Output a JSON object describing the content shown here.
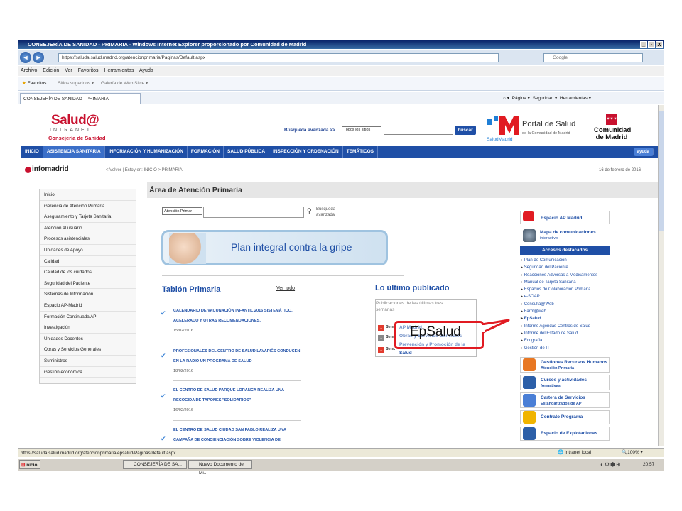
{
  "window": {
    "title": "CONSEJERÍA DE SANIDAD - PRIMARIA - Windows Internet Explorer proporcionado por Comunidad de Madrid",
    "controls": [
      "_",
      "▫",
      "X"
    ]
  },
  "browser": {
    "url": "https://saluda.salud.madrid.org/atencionprimaria/Paginas/Default.aspx",
    "search_placeholder": "Google",
    "menu": [
      "Archivo",
      "Edición",
      "Ver",
      "Favoritos",
      "Herramientas",
      "Ayuda"
    ],
    "favorites_label": "Favoritos",
    "suggested_sites": "Sitios sugeridos ▾",
    "web_slice": "Galería de Web Slice ▾",
    "tab_title": "CONSEJERÍA DE SANIDAD - PRIMARIA",
    "command_bar": [
      "Página ▾",
      "Seguridad ▾",
      "Herramientas ▾"
    ]
  },
  "header": {
    "logo_main": "Salud@",
    "logo_sub": "INTRANET",
    "logo_org": "Consejería de Sanidad",
    "advanced_search": "Búsqueda avanzada >>",
    "sites_select": "Todos los sitios",
    "search_button": "buscar",
    "portal_title": "Portal de Salud",
    "portal_sub": "de la Comunidad de Madrid",
    "salud_madrid": "SaludMadrid",
    "comunidad": "Comunidad de Madrid"
  },
  "nav": {
    "items": [
      "INICIO",
      "ASISTENCIA SANITARIA",
      "INFORMACIÓN Y HUMANIZACIÓN",
      "FORMACIÓN",
      "SALUD PÚBLICA",
      "INSPECCIÓN Y ORDENACIÓN",
      "TEMÁTICOS"
    ],
    "help": "ayuda"
  },
  "breadcrumb": {
    "site": "infomadrid",
    "back": "< Volver",
    "path": "Estoy en: INICIO > PRIMARIA",
    "date": "16 de febrero de 2016"
  },
  "sidebar": {
    "items": [
      "Inicio",
      "Gerencia de Atención Primaria",
      "Aseguramiento y Tarjeta Sanitaria",
      "Atención al usuario",
      "Procesos asistenciales",
      "Unidades de Apoyo",
      "Calidad",
      "Calidad de los cuidados",
      "Seguridad del Paciente",
      "Sistemas de Información",
      "Espacio AP-Madrid",
      "Formación Continuada AP",
      "Investigación",
      "Unidades Docentes",
      "Obras y Servicios Generales",
      "Suministros",
      "Gestión económica"
    ]
  },
  "main": {
    "title": "Área de Atención Primaria",
    "select": "Atención Primar",
    "adv_search": "Búsqueda avanzada",
    "banner": "Plan integral contra la gripe",
    "tablon_title": "Tablón Primaria",
    "ver_todo": "Ver todo",
    "news": [
      {
        "title": "CALENDARIO DE VACUNACIÓN INFANTIL 2016 SISTEMÁTICO, ACELERADO Y OTRAS RECOMENDACIONES.",
        "date": "15/02/2016"
      },
      {
        "title": "PROFESIONALES DEL CENTRO DE SALUD LAVAPIÉS CONDUCEN EN LA RADIO UN PROGRAMA DE SALUD",
        "date": "18/02/2016"
      },
      {
        "title": "EL CENTRO DE SALUD PARQUE LORANCA REALIZA UNA RECOGIDA DE TAPONES \"SOLIDARIOS\"",
        "date": "16/02/2016"
      },
      {
        "title": "EL CENTRO DE SALUD CIUDAD SAN PABLO REALIZA UNA CAMPAÑA DE CONCIENCIACIÓN SOBRE VIOLENCIA DE",
        "date": ""
      }
    ],
    "ultimo_title": "Lo último publicado",
    "ultimo_text": "Publicaciones de las últimas tres semanas",
    "ultimo_badges": [
      "1",
      "1",
      "1"
    ],
    "ultimo_sem": [
      "Sem",
      "Sem",
      "Sem."
    ],
    "ultimo_links": [
      "AP Madrid",
      "Obras y Servicios Generales",
      "Prevención y Promoción de la Salud"
    ]
  },
  "callout": {
    "text": "EpSalud"
  },
  "right": {
    "espacio": "Espacio AP Madrid",
    "mapa_title": "Mapa de comunicaciones",
    "mapa_sub": "interactivo",
    "accesos": "Accesos destacados",
    "links": [
      "Plan de Comunicación",
      "Seguridad del Paciente",
      "Reacciones Adversas a Medicamentos",
      "Manual de Tarjeta Sanitaria",
      "Espacios de Colaboración Primaria",
      "e-SOAP",
      "Consulta@Web",
      "Farm@web",
      "EpSalud",
      "Informe Agendas Centros de Salud",
      "Informe del Estado de Salud",
      "Ecografía",
      "Gestión de IT"
    ],
    "cards": [
      {
        "title": "Gestiones Recursos Humanos",
        "sub": "Atención Primaria"
      },
      {
        "title": "Cursos y actividades",
        "sub": "formativas"
      },
      {
        "title": "Cartera de Servicios",
        "sub": "Estandarizados de AP"
      },
      {
        "title": "Contrato Programa",
        "sub": ""
      },
      {
        "title": "Espacio de Explotaciones",
        "sub": ""
      }
    ]
  },
  "status": {
    "url": "https://saluda.salud.madrid.org/atencionprimaria/epsalud/Paginas/default.aspx",
    "zone": "Intranet local",
    "zoom": "100% ▾"
  },
  "taskbar": {
    "start": "Inicio",
    "tasks": [
      "CONSEJERÍA DE SA...",
      "Nuevo Documento de Mi..."
    ],
    "clock": "20:57"
  }
}
